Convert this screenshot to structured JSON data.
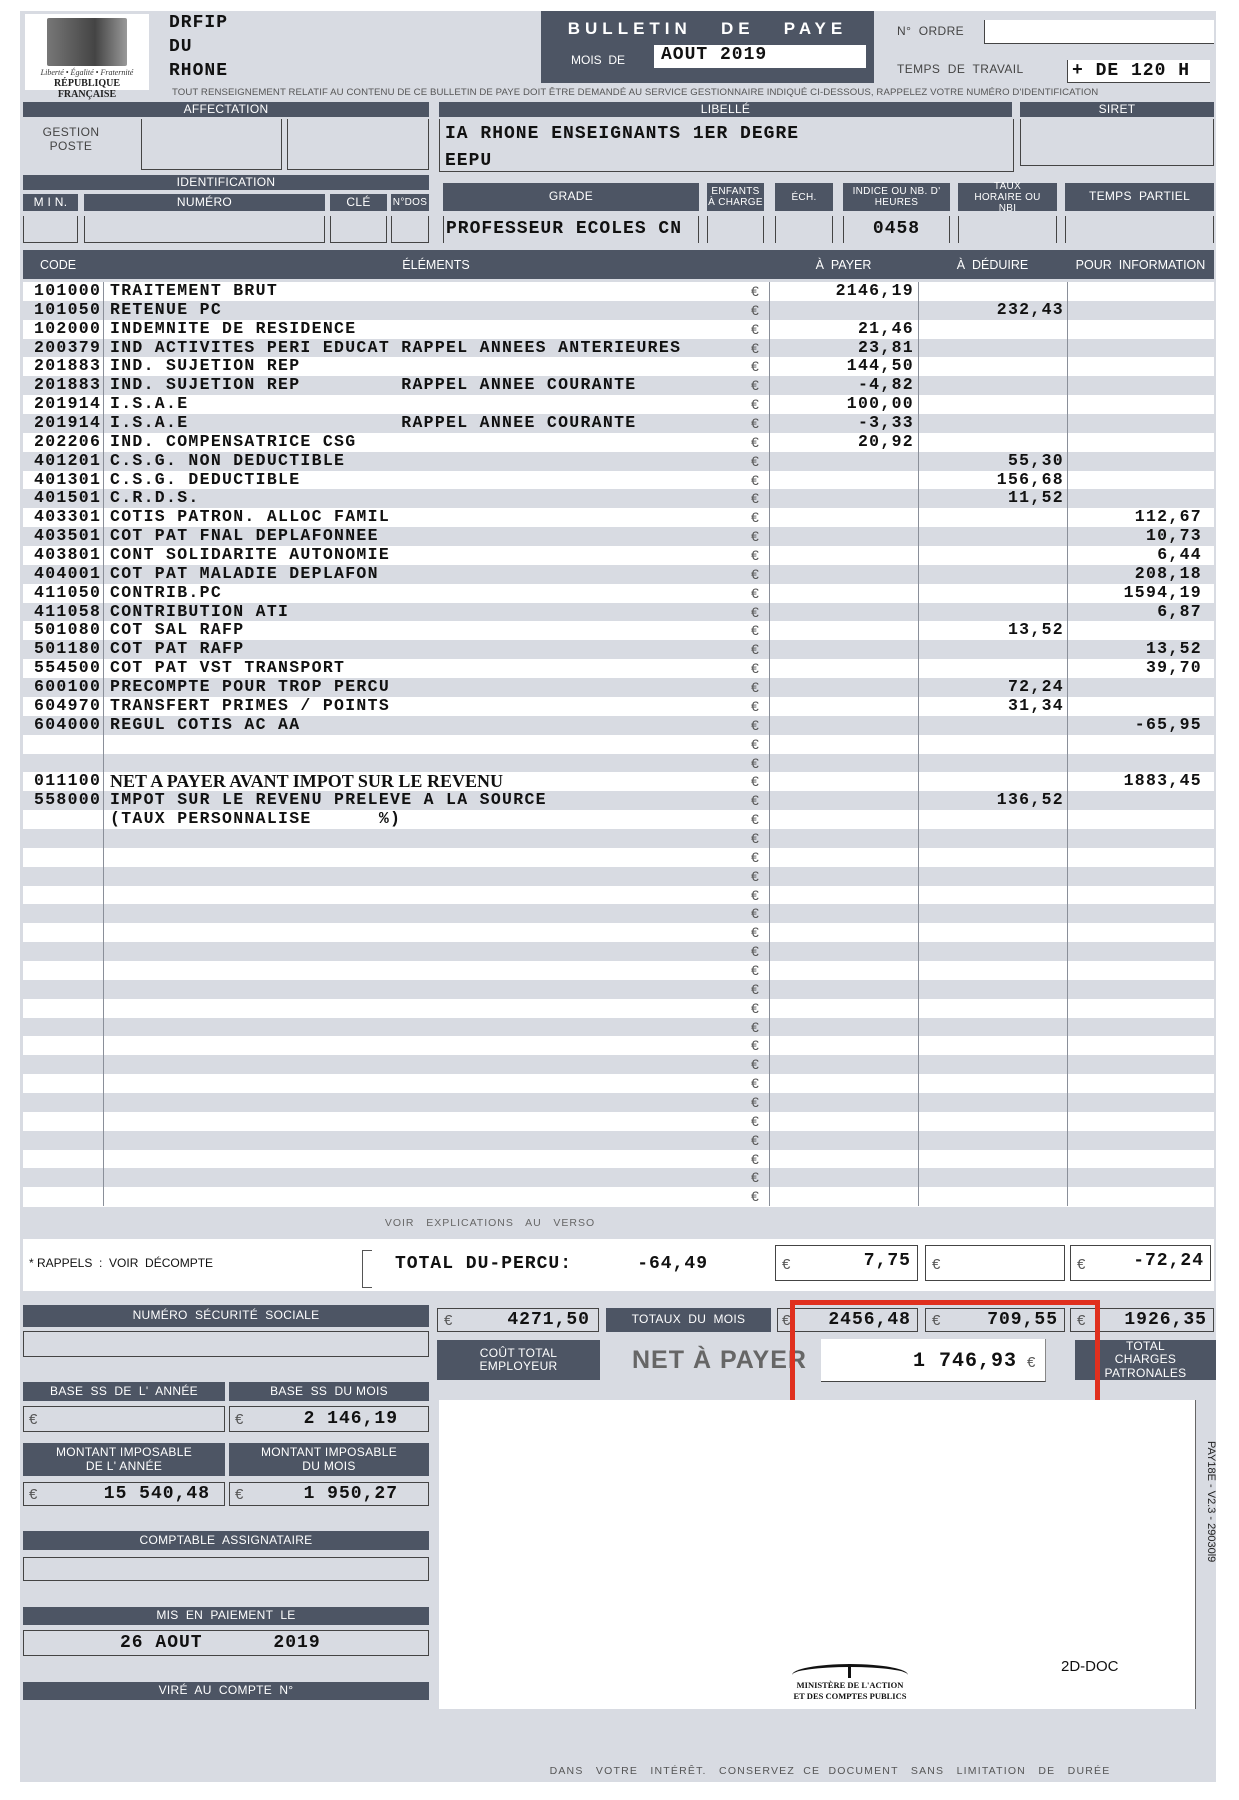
{
  "header": {
    "logo": {
      "motto": "Liberté • Égalité • Fraternité",
      "name": "RÉPUBLIQUE FRANÇAISE"
    },
    "issuer_lines": [
      "DRFIP",
      "DU",
      "RHONE"
    ],
    "title": "BULLETIN   DE   PAYE",
    "month_label": "MOIS  DE",
    "month_value": "AOUT 2019",
    "order_label": "N°  ORDRE",
    "order_value": "",
    "work_time_label": "TEMPS  DE  TRAVAIL",
    "work_time_value": "+ DE 120 H",
    "notice": "TOUT RENSEIGNEMENT RELATIF AU CONTENU DE CE BULLETIN DE PAYE DOIT ÊTRE DEMANDÉ AU SERVICE GESTIONNAIRE INDIQUÉ CI-DESSOUS, RAPPELEZ VOTRE NUMÉRO D'IDENTIFICATION"
  },
  "affectation": {
    "label": "AFFECTATION",
    "gestion_label": "GESTION",
    "poste_label": "POSTE"
  },
  "libelle": {
    "label": "LIBELLÉ",
    "line1": "IA RHONE ENSEIGNANTS 1ER DEGRE",
    "line2": "EEPU"
  },
  "siret": {
    "label": "SIRET",
    "value": ""
  },
  "identification": {
    "label": "IDENTIFICATION",
    "min": "M I N.",
    "numero": "NUMÉRO",
    "cle": "CLÉ",
    "ndos": "N°DOS"
  },
  "grade": {
    "grade_label": "GRADE",
    "enfants_label": "ENFANTS À CHARGE",
    "ech_label": "ÉCH.",
    "indice_label": "INDICE  OU NB.  D' HEURES",
    "taux_label": "TAUX HORAIRE OU NBI",
    "temps_label": "TEMPS  PARTIEL",
    "grade_value": "PROFESSEUR ECOLES CN",
    "indice_value": "0458"
  },
  "table": {
    "headers": {
      "code": "CODE",
      "elements": "ÉLÉMENTS",
      "pay": "À  PAYER",
      "deduct": "À  DÉDUIRE",
      "info": "POUR  INFORMATION"
    },
    "currency": "€",
    "rows": [
      {
        "code": "101000",
        "label": "TRAITEMENT BRUT",
        "pay": "2146,19",
        "deduct": "",
        "info": ""
      },
      {
        "code": "101050",
        "label": "RETENUE PC",
        "pay": "",
        "deduct": "232,43",
        "info": ""
      },
      {
        "code": "102000",
        "label": "INDEMNITE DE RESIDENCE",
        "pay": "21,46",
        "deduct": "",
        "info": ""
      },
      {
        "code": "200379",
        "label": "IND ACTIVITES PERI EDUCAT RAPPEL ANNEES ANTERIEURES",
        "pay": "23,81",
        "deduct": "",
        "info": ""
      },
      {
        "code": "201883",
        "label": "IND. SUJETION REP",
        "pay": "144,50",
        "deduct": "",
        "info": ""
      },
      {
        "code": "201883",
        "label": "IND. SUJETION REP         RAPPEL ANNEE COURANTE",
        "pay": "-4,82",
        "deduct": "",
        "info": ""
      },
      {
        "code": "201914",
        "label": "I.S.A.E",
        "pay": "100,00",
        "deduct": "",
        "info": ""
      },
      {
        "code": "201914",
        "label": "I.S.A.E                   RAPPEL ANNEE COURANTE",
        "pay": "-3,33",
        "deduct": "",
        "info": ""
      },
      {
        "code": "202206",
        "label": "IND. COMPENSATRICE CSG",
        "pay": "20,92",
        "deduct": "",
        "info": ""
      },
      {
        "code": "401201",
        "label": "C.S.G. NON DEDUCTIBLE",
        "pay": "",
        "deduct": "55,30",
        "info": ""
      },
      {
        "code": "401301",
        "label": "C.S.G. DEDUCTIBLE",
        "pay": "",
        "deduct": "156,68",
        "info": ""
      },
      {
        "code": "401501",
        "label": "C.R.D.S.",
        "pay": "",
        "deduct": "11,52",
        "info": ""
      },
      {
        "code": "403301",
        "label": "COTIS PATRON. ALLOC FAMIL",
        "pay": "",
        "deduct": "",
        "info": "112,67"
      },
      {
        "code": "403501",
        "label": "COT PAT FNAL DEPLAFONNEE",
        "pay": "",
        "deduct": "",
        "info": "10,73"
      },
      {
        "code": "403801",
        "label": "CONT SOLIDARITE AUTONOMIE",
        "pay": "",
        "deduct": "",
        "info": "6,44"
      },
      {
        "code": "404001",
        "label": "COT PAT MALADIE DEPLAFON",
        "pay": "",
        "deduct": "",
        "info": "208,18"
      },
      {
        "code": "411050",
        "label": "CONTRIB.PC",
        "pay": "",
        "deduct": "",
        "info": "1594,19"
      },
      {
        "code": "411058",
        "label": "CONTRIBUTION ATI",
        "pay": "",
        "deduct": "",
        "info": "6,87"
      },
      {
        "code": "501080",
        "label": "COT SAL RAFP",
        "pay": "",
        "deduct": "13,52",
        "info": ""
      },
      {
        "code": "501180",
        "label": "COT PAT RAFP",
        "pay": "",
        "deduct": "",
        "info": "13,52"
      },
      {
        "code": "554500",
        "label": "COT PAT VST TRANSPORT",
        "pay": "",
        "deduct": "",
        "info": "39,70"
      },
      {
        "code": "600100",
        "label": "PRECOMPTE POUR TROP PERCU",
        "pay": "",
        "deduct": "72,24",
        "info": ""
      },
      {
        "code": "604970",
        "label": "TRANSFERT PRIMES / POINTS",
        "pay": "",
        "deduct": "31,34",
        "info": ""
      },
      {
        "code": "604000",
        "label": "REGUL COTIS AC AA",
        "pay": "",
        "deduct": "",
        "info": "-65,95"
      },
      {
        "code": "",
        "label": "",
        "pay": "",
        "deduct": "",
        "info": ""
      },
      {
        "code": "",
        "label": "",
        "pay": "",
        "deduct": "",
        "info": ""
      },
      {
        "code": "011100",
        "label": "NET A PAYER AVANT IMPOT SUR LE REVENU",
        "pay": "",
        "deduct": "",
        "info": "1883,45"
      },
      {
        "code": "558000",
        "label": "IMPOT SUR LE REVENU PRELEVE A LA SOURCE",
        "pay": "",
        "deduct": "136,52",
        "info": ""
      },
      {
        "code": "",
        "label": "(TAUX PERSONNALISE      %)",
        "pay": "",
        "deduct": "",
        "info": ""
      }
    ],
    "total_rows": 49
  },
  "footer": {
    "verso": "VOIR   EXPLICATIONS   AU   VERSO",
    "rappels": "* RAPPELS  :  VOIR  DÉCOMPTE",
    "total_du_percu_label": "TOTAL DU-PERCU:",
    "total_du_percu_value": "-64,49",
    "total_pay": "7,75",
    "total_deduct": "",
    "total_info": "-72,24",
    "nss_label": "NUMÉRO  SÉCURITÉ  SOCIALE",
    "nss_value": "",
    "cout_total": "4271,50",
    "totaux_label": "TOTAUX  DU  MOIS",
    "totaux_pay": "2456,48",
    "totaux_deduct": "709,55",
    "totaux_info": "1926,35",
    "cout_label": "COÛT  TOTAL EMPLOYEUR",
    "net_label": "NET À PAYER",
    "net_value": "1 746,93",
    "charges_label": "TOTAL  CHARGES PATRONALES",
    "base_ss_annee_label": "BASE  SS  DE  L'  ANNÉE",
    "base_ss_annee_value": "",
    "base_ss_mois_label": "BASE  SS  DU MOIS",
    "base_ss_mois_value": "2 146,19",
    "imposable_annee_label": "MONTANT  IMPOSABLE DE  L'  ANNÉE",
    "imposable_annee_value": "15 540,48",
    "imposable_mois_label": "MONTANT  IMPOSABLE DU MOIS",
    "imposable_mois_value": "1 950,27",
    "comptable_label": "COMPTABLE  ASSIGNATAIRE",
    "comptable_value": "",
    "paiement_label": "MIS  EN  PAIEMENT  LE",
    "paiement_value": "26 AOUT      2019",
    "vire_label": "VIRÉ  AU  COMPTE  N°",
    "ministry": "MINISTÈRE DE L'ACTION ET DES COMPTES PUBLICS",
    "ministry_line1": "MINISTÈRE DE L'ACTION",
    "ministry_line2": "ET DES COMPTES PUBLICS",
    "doc2d": "2D-DOC",
    "version": "PAY18E - V2.3 - 29030l9",
    "keep_notice": "DANS   VOTRE   INTÉRÊT.   CONSERVEZ  CE  DOCUMENT   SANS   LIMITATION   DE   DURÉE"
  },
  "colors": {
    "bar": "#4d5564",
    "background": "#d8dbe2",
    "highlight": "#e0301e"
  }
}
